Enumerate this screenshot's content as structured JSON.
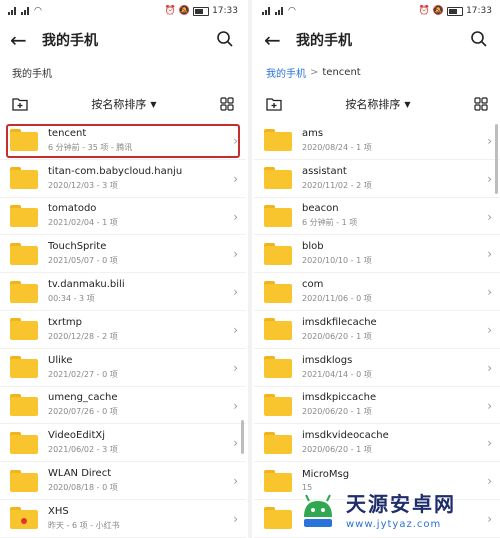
{
  "status": {
    "time": "17:33"
  },
  "left": {
    "title": "我的手机",
    "breadcrumb": "我的手机",
    "sort_label": "按名称排序",
    "items": [
      {
        "name": "tencent",
        "meta": "6 分钟前 - 35 项 - 腾讯",
        "highlighted": true
      },
      {
        "name": "titan-com.babycloud.hanju",
        "meta": "2020/12/03 - 3 项"
      },
      {
        "name": "tomatodo",
        "meta": "2021/02/04 - 1 项"
      },
      {
        "name": "TouchSprite",
        "meta": "2021/05/07 - 0 项"
      },
      {
        "name": "tv.danmaku.bili",
        "meta": "00:34 - 3 项"
      },
      {
        "name": "txrtmp",
        "meta": "2020/12/28 - 2 项"
      },
      {
        "name": "Ulike",
        "meta": "2021/02/27 - 0 项"
      },
      {
        "name": "umeng_cache",
        "meta": "2020/07/26 - 0 项"
      },
      {
        "name": "VideoEditXj",
        "meta": "2021/06/02 - 3 项"
      },
      {
        "name": "WLAN Direct",
        "meta": "2020/08/18 - 0 项"
      },
      {
        "name": "XHS",
        "meta": "昨天 - 6 项 - 小红书",
        "badge": true
      }
    ]
  },
  "right": {
    "title": "我的手机",
    "breadcrumb_root": "我的手机",
    "breadcrumb_current": "tencent",
    "sort_label": "按名称排序",
    "items": [
      {
        "name": "ams",
        "meta": "2020/08/24 - 1 项"
      },
      {
        "name": "assistant",
        "meta": "2020/11/02 - 2 项"
      },
      {
        "name": "beacon",
        "meta": "6 分钟前 - 1 项"
      },
      {
        "name": "blob",
        "meta": "2020/10/10 - 1 项"
      },
      {
        "name": "com",
        "meta": "2020/11/06 - 0 项"
      },
      {
        "name": "imsdkfilecache",
        "meta": "2020/06/20 - 1 项"
      },
      {
        "name": "imsdklogs",
        "meta": "2021/04/14 - 0 项"
      },
      {
        "name": "imsdkpiccache",
        "meta": "2020/06/20 - 1 项"
      },
      {
        "name": "imsdkvideocache",
        "meta": "2020/06/20 - 1 项"
      },
      {
        "name": "MicroMsg",
        "meta": "15"
      },
      {
        "name": "",
        "meta": ""
      }
    ]
  },
  "watermark": {
    "name": "天源安卓网",
    "url": "www.jytyaz.com"
  },
  "colors": {
    "folder": "#f9c52e",
    "highlight": "#c62d2d",
    "link": "#2a73d8"
  }
}
